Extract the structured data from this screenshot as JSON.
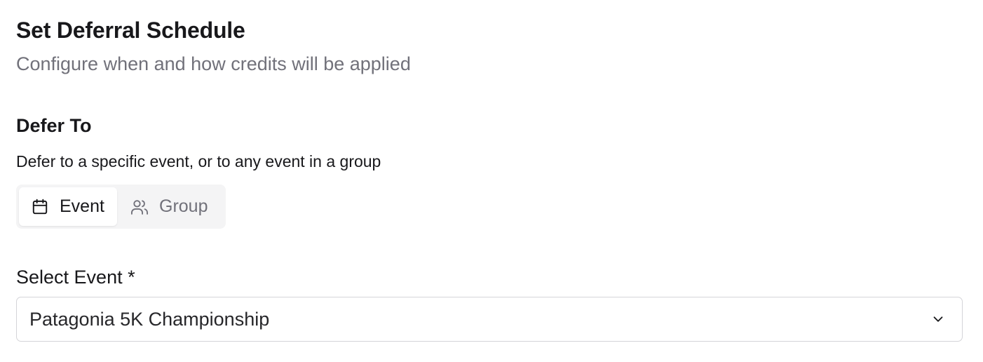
{
  "header": {
    "title": "Set Deferral Schedule",
    "subtitle": "Configure when and how credits will be applied"
  },
  "defer_to": {
    "label": "Defer To",
    "description": "Defer to a specific event, or to any event in a group",
    "options": [
      {
        "label": "Event",
        "icon": "calendar-icon",
        "selected": true
      },
      {
        "label": "Group",
        "icon": "users-icon",
        "selected": false
      }
    ]
  },
  "select_event": {
    "label": "Select Event *",
    "value": "Patagonia 5K Championship",
    "icon": "chevron-down-icon"
  },
  "colors": {
    "text_primary": "#18181b",
    "text_muted": "#71717a",
    "toggle_bg": "#f4f4f5",
    "border": "#d4d4d8"
  }
}
